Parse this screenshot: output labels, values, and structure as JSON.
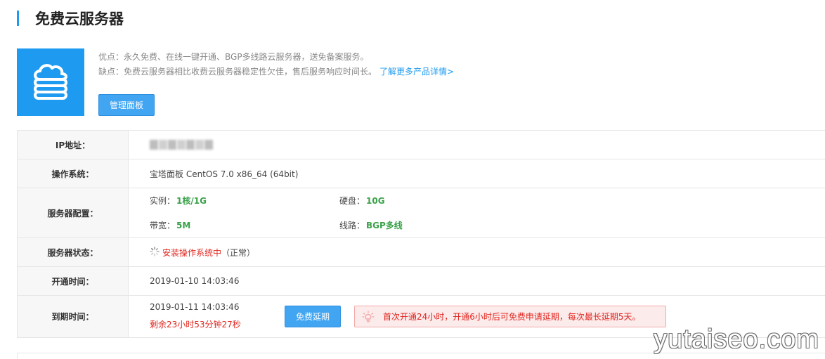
{
  "page": {
    "title": "免费云服务器",
    "accent_color": "#1e9bf0"
  },
  "product": {
    "icon": "cloud-server-icon",
    "pros": "优点：永久免费、在线一键开通、BGP多线路云服务器，送免备案服务。",
    "cons": "缺点：免费云服务器相比收费云服务器稳定性欠佳，售后服务响应时间长。",
    "more_link": "了解更多产品详情>",
    "manage_button": "管理面板"
  },
  "info": {
    "ip_label": "IP地址：",
    "os_label": "操作系统：",
    "os_value": "宝塔面板 CentOS 7.0 x86_64 (64bit)",
    "config_label": "服务器配置：",
    "config": {
      "instance_label": "实例：",
      "instance_value": "1核/1G",
      "disk_label": "硬盘：",
      "disk_value": "10G",
      "bandwidth_label": "带宽：",
      "bandwidth_value": "5M",
      "line_label": "线路：",
      "line_value": "BGP多线"
    },
    "status_label": "服务器状态：",
    "status_icon": "loading-spinner-icon",
    "status_text": "安装操作系统中",
    "status_suffix": "（正常）",
    "open_label": "开通时间：",
    "open_time": "2019-01-10 14:03:46",
    "expire_label": "到期时间：",
    "expire_time": "2019-01-11 14:03:46",
    "remaining": "剩余23小时53分钟27秒",
    "renew_button": "免费延期",
    "notice_icon": "lightbulb-icon",
    "notice_text": "首次开通24小时，开通6小时后可免费申请延期，每次最长延期5天。"
  },
  "colors": {
    "green": "#3aa14a",
    "red": "#e0261f",
    "button": "#41a5f2"
  },
  "watermark": "yutaiseo.com"
}
